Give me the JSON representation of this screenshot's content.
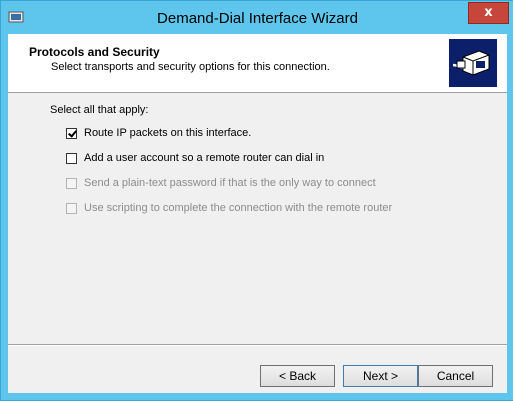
{
  "window": {
    "title": "Demand-Dial Interface Wizard",
    "close_label": "x"
  },
  "header": {
    "title": "Protocols and Security",
    "subtitle": "Select transports and security options for this connection."
  },
  "content": {
    "prompt": "Select all that apply:",
    "options": [
      {
        "label": "Route IP packets on this interface.",
        "checked": true,
        "enabled": true
      },
      {
        "label": "Add a user account so a remote router can dial in",
        "checked": false,
        "enabled": true
      },
      {
        "label": "Send a plain-text password if that is the only way to connect",
        "checked": false,
        "enabled": false
      },
      {
        "label": "Use scripting to complete the connection with the remote router",
        "checked": false,
        "enabled": false
      }
    ]
  },
  "footer": {
    "back_label": "< Back",
    "next_label": "Next >",
    "cancel_label": "Cancel"
  },
  "colors": {
    "titlebar": "#5ec6ec",
    "close": "#c7463b",
    "dialog_bg": "#f0f0f0",
    "header_image_bg": "#0b1f6b"
  }
}
